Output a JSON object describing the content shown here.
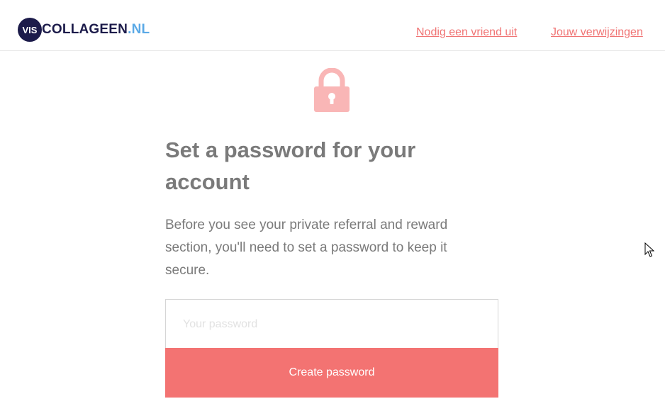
{
  "header": {
    "logo_badge": "VIS",
    "logo_main": "COLLAGEEN",
    "logo_ext": ".NL",
    "nav": [
      {
        "label": "Nodig een vriend uit"
      },
      {
        "label": "Jouw verwijzingen"
      }
    ]
  },
  "main": {
    "icon": "lock-icon",
    "title": "Set a password for your account",
    "description": "Before you see your private referral and reward section, you'll need to set a password to keep it secure.",
    "password": {
      "placeholder": "Your password",
      "value": ""
    },
    "submit_label": "Create password"
  },
  "colors": {
    "brand_navy": "#1c1b4a",
    "brand_blue": "#5aa9e6",
    "accent": "#f37372",
    "lock": "#f9b6b6",
    "text_gray": "#7a7a7a"
  }
}
